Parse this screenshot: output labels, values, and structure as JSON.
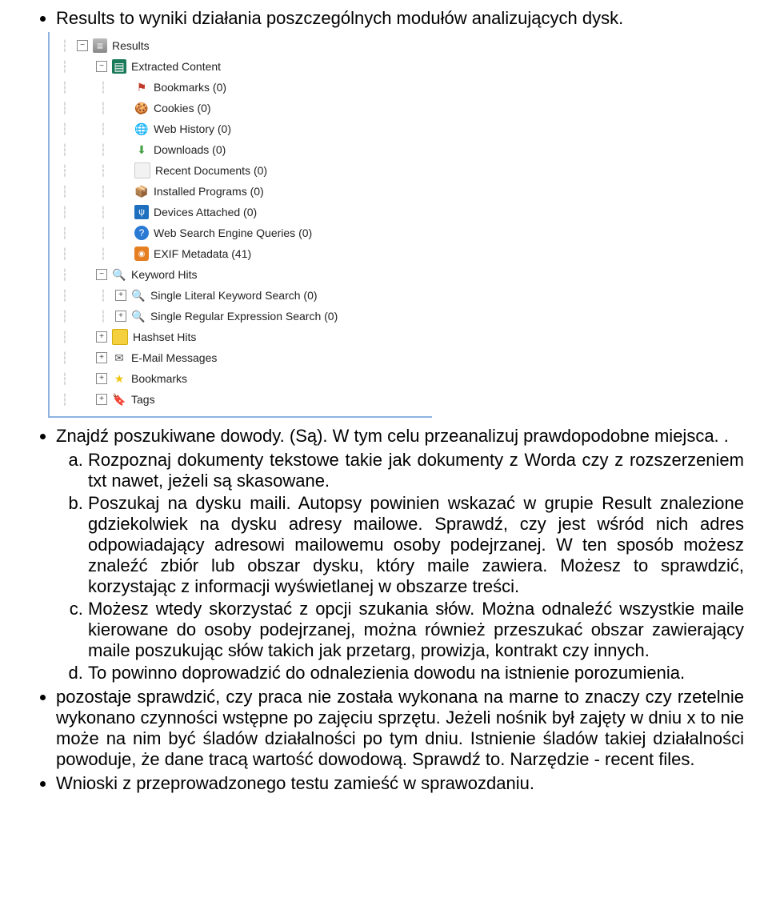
{
  "bullet1": "Results to wyniki działania poszczególnych modułów analizujących dysk.",
  "tree": {
    "results": "Results",
    "extracted": "Extracted Content",
    "bookmarks0": "Bookmarks (0)",
    "cookies0": "Cookies (0)",
    "webhist0": "Web History (0)",
    "downloads0": "Downloads (0)",
    "recent0": "Recent Documents (0)",
    "installed0": "Installed Programs (0)",
    "devices0": "Devices Attached (0)",
    "wseq0": "Web Search Engine Queries (0)",
    "exif41": "EXIF Metadata (41)",
    "kwhits": "Keyword Hits",
    "slks0": "Single Literal Keyword Search (0)",
    "sres0": "Single Regular Expression Search (0)",
    "hashset": "Hashset Hits",
    "emailmsg": "E-Mail Messages",
    "bookmarks": "Bookmarks",
    "tags": "Tags"
  },
  "bullet2_intro": "Znajdź poszukiwane dowody. (Są). W tym celu przeanalizuj prawdopodobne miejsca. .",
  "sub_a": "Rozpoznaj dokumenty tekstowe takie jak dokumenty z Worda czy z rozszerzeniem txt nawet, jeżeli są skasowane.",
  "sub_b": "Poszukaj na dysku maili. Autopsy powinien wskazać w grupie Result znalezione gdziekolwiek na dysku adresy mailowe. Sprawdź, czy jest wśród nich adres odpowiadający adresowi mailowemu osoby podejrzanej. W ten sposób możesz znaleźć zbiór lub obszar dysku, który maile zawiera. Możesz to sprawdzić, korzystając z informacji wyświetlanej w obszarze treści.",
  "sub_c": "Możesz wtedy skorzystać z opcji szukania słów. Można odnaleźć wszystkie maile kierowane do osoby podejrzanej, można również przeszukać obszar zawierający maile poszukując słów takich jak przetarg, prowizja, kontrakt czy innych.",
  "sub_d": "To powinno doprowadzić do odnalezienia dowodu na istnienie porozumienia.",
  "bullet3": "pozostaje sprawdzić, czy praca nie została wykonana na marne to znaczy czy rzetelnie wykonano czynności wstępne po zajęciu sprzętu. Jeżeli nośnik był zajęty w dniu x to nie może na nim być śladów działalności po tym dniu. Istnienie śladów takiej działalności  powoduje, że dane tracą wartość dowodową. Sprawdź to. Narzędzie  - recent files.",
  "bullet4": "Wnioski z przeprowadzonego testu zamieść w sprawozdaniu."
}
